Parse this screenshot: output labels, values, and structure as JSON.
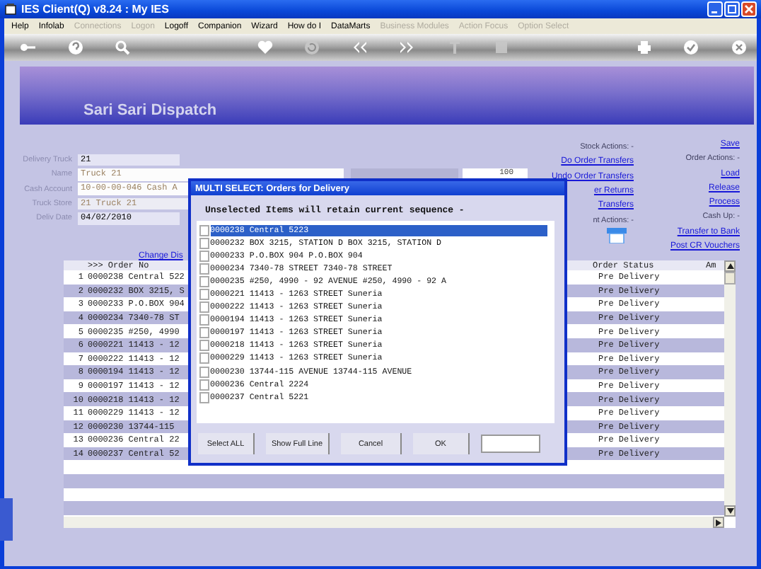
{
  "window": {
    "title": "IES Client(Q) v8.24 : My IES"
  },
  "menu": [
    {
      "label": "Help",
      "disabled": false
    },
    {
      "label": "Infolab",
      "disabled": false
    },
    {
      "label": "Connections",
      "disabled": true
    },
    {
      "label": "Logon",
      "disabled": true
    },
    {
      "label": "Logoff",
      "disabled": false
    },
    {
      "label": "Companion",
      "disabled": false
    },
    {
      "label": "Wizard",
      "disabled": false
    },
    {
      "label": "How do I",
      "disabled": false
    },
    {
      "label": "DataMarts",
      "disabled": false
    },
    {
      "label": "Business Modules",
      "disabled": true
    },
    {
      "label": "Action Focus",
      "disabled": true
    },
    {
      "label": "Option Select",
      "disabled": true
    }
  ],
  "page": {
    "title": "Sari Sari Dispatch"
  },
  "form": {
    "fields": [
      {
        "label": "Delivery Truck",
        "value": "21",
        "kind": "input"
      },
      {
        "label": "Name",
        "value": "Truck 21",
        "kind": "readonly"
      },
      {
        "label": "Cash Account",
        "value": "10-00-00-046 Cash A",
        "kind": "readonly"
      },
      {
        "label": "Truck Store",
        "value": "21 Truck 21",
        "kind": "readonly"
      },
      {
        "label": "Deliv Date",
        "value": "04/02/2010",
        "kind": "input"
      }
    ],
    "amount": "100",
    "change_link": "Change Dis"
  },
  "stock_actions": [
    {
      "kind": "label",
      "text": "Stock Actions: -"
    },
    {
      "kind": "link",
      "text": "Do Order Transfers"
    },
    {
      "kind": "link",
      "text": "Undo Order Transfers"
    },
    {
      "kind": "link",
      "text": "er Returns"
    },
    {
      "kind": "link",
      "text": "Transfers"
    },
    {
      "kind": "label",
      "text": "nt Actions: -"
    },
    {
      "kind": "icon"
    }
  ],
  "order_actions": [
    {
      "kind": "link",
      "text": "Save"
    },
    {
      "kind": "label",
      "text": "Order Actions: -"
    },
    {
      "kind": "link",
      "text": "Load"
    },
    {
      "kind": "link",
      "text": "Release"
    },
    {
      "kind": "link",
      "text": "Process"
    },
    {
      "kind": "label",
      "text": "Cash Up: -"
    },
    {
      "kind": "link",
      "text": "Transfer to Bank"
    },
    {
      "kind": "link",
      "text": "Post CR Vouchers"
    }
  ],
  "table": {
    "columns": [
      ">>> Order No",
      "Order Status",
      "Am"
    ],
    "rows": [
      {
        "number": "1",
        "order": "0000238 Central 522",
        "status": "Pre Delivery"
      },
      {
        "number": "2",
        "order": "0000232 BOX 3215, S",
        "status": "Pre Delivery"
      },
      {
        "number": "3",
        "order": "0000233 P.O.BOX 904",
        "status": "Pre Delivery"
      },
      {
        "number": "4",
        "order": "0000234 7340-78 ST",
        "status": "Pre Delivery"
      },
      {
        "number": "5",
        "order": "0000235 #250, 4990",
        "status": "Pre Delivery"
      },
      {
        "number": "6",
        "order": "0000221 11413 - 12",
        "status": "Pre Delivery"
      },
      {
        "number": "7",
        "order": "0000222 11413 - 12",
        "status": "Pre Delivery"
      },
      {
        "number": "8",
        "order": "0000194 11413 - 12",
        "status": "Pre Delivery"
      },
      {
        "number": "9",
        "order": "0000197 11413 - 12",
        "status": "Pre Delivery"
      },
      {
        "number": "10",
        "order": "0000218 11413 - 12",
        "status": "Pre Delivery"
      },
      {
        "number": "11",
        "order": "0000229 11413 - 12",
        "status": "Pre Delivery"
      },
      {
        "number": "12",
        "order": "0000230 13744-115",
        "status": "Pre Delivery"
      },
      {
        "number": "13",
        "order": "0000236 Central 22",
        "status": "Pre Delivery"
      },
      {
        "number": "14",
        "order": "0000237 Central 52",
        "status": "Pre Delivery"
      }
    ]
  },
  "dialog": {
    "title": "MULTI SELECT: Orders for Delivery",
    "subtitle": "Unselected Items will retain current sequence -",
    "items": [
      {
        "text": "0000238 Central 5223",
        "checked": false,
        "selected": true
      },
      {
        "text": "0000232 BOX 3215, STATION D BOX 3215, STATION D",
        "checked": false,
        "selected": false
      },
      {
        "text": "0000233 P.O.BOX 904 P.O.BOX 904",
        "checked": false,
        "selected": false
      },
      {
        "text": "0000234 7340-78 STREET 7340-78 STREET",
        "checked": false,
        "selected": false
      },
      {
        "text": "0000235 #250, 4990 - 92 AVENUE #250, 4990 - 92 A",
        "checked": false,
        "selected": false
      },
      {
        "text": "0000221 11413 - 1263 STREET Suneria",
        "checked": false,
        "selected": false
      },
      {
        "text": "0000222 11413 - 1263 STREET Suneria",
        "checked": false,
        "selected": false
      },
      {
        "text": "0000194 11413 - 1263 STREET Suneria",
        "checked": false,
        "selected": false
      },
      {
        "text": "0000197 11413 - 1263 STREET Suneria",
        "checked": false,
        "selected": false
      },
      {
        "text": "0000218 11413 - 1263 STREET Suneria",
        "checked": false,
        "selected": false
      },
      {
        "text": "0000229 11413 - 1263 STREET Suneria",
        "checked": false,
        "selected": false
      },
      {
        "text": "0000230 13744-115 AVENUE 13744-115 AVENUE",
        "checked": false,
        "selected": false
      },
      {
        "text": "0000236 Central 2224",
        "checked": false,
        "selected": false
      },
      {
        "text": "0000237 Central 5221",
        "checked": false,
        "selected": false
      }
    ],
    "buttons": [
      "Select ALL",
      "Show Full Line",
      "Cancel",
      "OK"
    ]
  }
}
